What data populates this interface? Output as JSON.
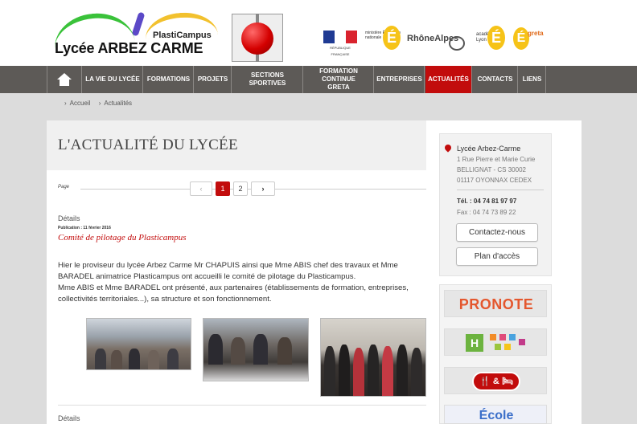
{
  "header": {
    "plasticampus": "PlastiCampus",
    "lycee_name": "Lycée ARBEZ CARME",
    "partners": {
      "republique": "RÉPUBLIQUE FRANÇAISE",
      "ministere": "ministère Éducation nationale",
      "ministere_e": "É",
      "rhone_alpes": "RhôneAlpes",
      "academie": "académie Lyon",
      "academie_e": "É",
      "greta": "greta",
      "greta_e": "É"
    }
  },
  "nav": {
    "items": [
      {
        "label": "LA VIE DU LYCÉE",
        "active": false
      },
      {
        "label": "FORMATIONS",
        "active": false
      },
      {
        "label": "PROJETS",
        "active": false
      },
      {
        "label": "SECTIONS SPORTIVES",
        "active": false
      },
      {
        "label": "FORMATION CONTINUE GRETA",
        "active": false
      },
      {
        "label": "ENTREPRISES",
        "active": false
      },
      {
        "label": "ACTUALITÉS",
        "active": true
      },
      {
        "label": "CONTACTS",
        "active": false
      },
      {
        "label": "LIENS",
        "active": false
      }
    ]
  },
  "breadcrumb": {
    "home": "Accueil",
    "current": "Actualités",
    "sep": "›"
  },
  "page": {
    "title": "L'ACTUALITÉ DU LYCÉE",
    "pagination": {
      "label": "Page",
      "prev": "‹",
      "pages": [
        "1",
        "2"
      ],
      "next": "›",
      "current": "1"
    }
  },
  "article": {
    "details_label": "Détails",
    "publication": "Publication : 11 février 2016",
    "title": "Comité de pilotage du Plasticampus",
    "body": [
      "Hier le proviseur du lycée Arbez Carme Mr CHAPUIS ainsi que Mme ABIS chef des travaux et Mme BARADEL animatrice Plasticampus ont accueilli le comité de pilotage du Plasticampus.",
      "Mme ABIS et Mme BARADEL ont présenté, aux partenaires (établissements de formation, entreprises, collectivités territoriales...), sa structure et son fonctionnement."
    ]
  },
  "article2": {
    "details_label": "Détails"
  },
  "contact": {
    "name": "Lycée Arbez-Carme",
    "address": [
      "1 Rue Pierre et Marie Curie",
      "BELLIGNAT - CS 30002",
      "01117 OYONNAX CEDEX"
    ],
    "tel": "Tél. : 04 74 81 97 97",
    "fax": "Fax : 04 74 73 89 22",
    "contact_button": "Contactez-nous",
    "map_button": "Plan d'accès"
  },
  "links": {
    "pronote": "PRONOTE",
    "hub": "H",
    "resto": "🍴 & 🛏",
    "ecole": "École"
  },
  "colors": {
    "accent": "#c20c0c",
    "nav_bg": "#5d5a57",
    "page_bg": "#dcdcdc"
  }
}
